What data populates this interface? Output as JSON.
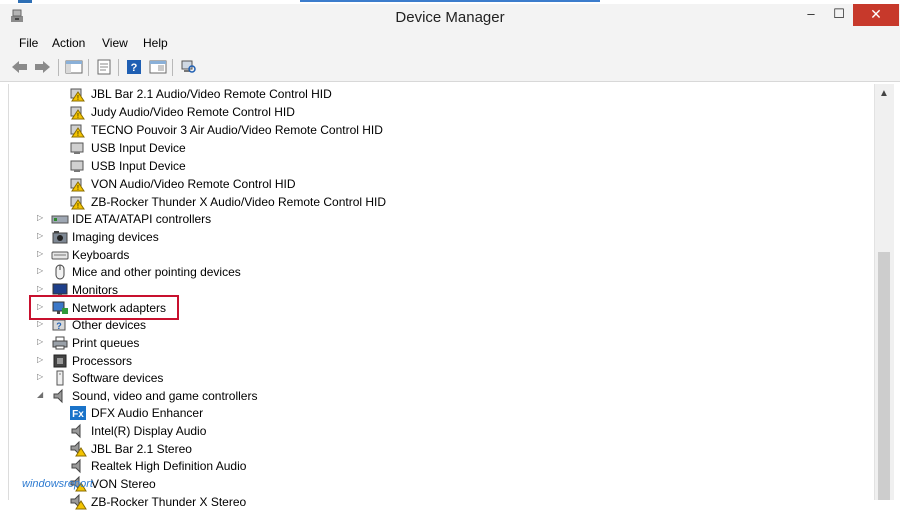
{
  "window": {
    "title": "Device Manager"
  },
  "menu": {
    "file": "File",
    "action": "Action",
    "view": "View",
    "help": "Help"
  },
  "tree": {
    "hid_children": [
      "JBL Bar 2.1 Audio/Video Remote Control HID",
      "Judy Audio/Video Remote Control HID",
      "TECNO Pouvoir 3 Air Audio/Video Remote Control HID",
      "USB Input Device",
      "USB Input Device",
      "VON Audio/Video Remote Control HID",
      "ZB-Rocker Thunder X Audio/Video Remote Control HID"
    ],
    "ide": "IDE ATA/ATAPI controllers",
    "imaging": "Imaging devices",
    "keyboards": "Keyboards",
    "mice": "Mice and other pointing devices",
    "monitors": "Monitors",
    "network": "Network adapters",
    "other": "Other devices",
    "print": "Print queues",
    "processors": "Processors",
    "software": "Software devices",
    "sound": "Sound, video and game controllers",
    "sound_children": [
      "DFX Audio Enhancer",
      "Intel(R) Display Audio",
      "JBL Bar 2.1 Stereo",
      "Realtek High Definition Audio",
      "VON Stereo",
      "ZB-Rocker Thunder X Stereo"
    ]
  },
  "expander_collapsed": "▷",
  "expander_expanded": "◢",
  "watermark": "windowsreport",
  "colors": {
    "highlight": "#c8102e",
    "close_button": "#c7392b"
  }
}
